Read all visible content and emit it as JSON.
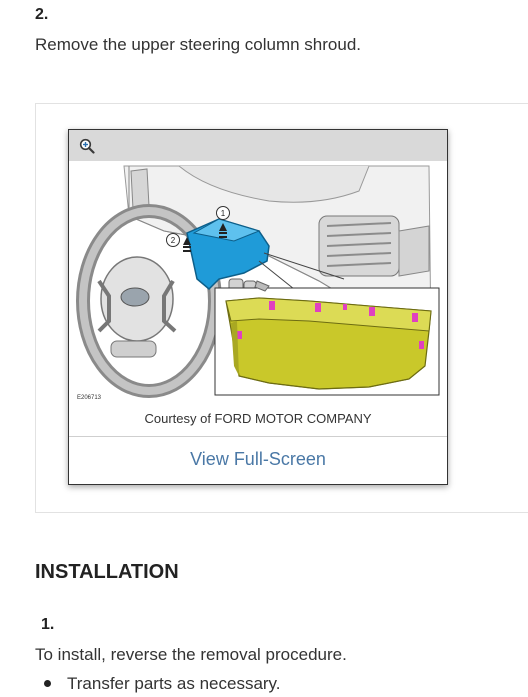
{
  "step": {
    "number": "2.",
    "instruction": "Remove the upper steering column shroud."
  },
  "figure": {
    "figure_id": "E206713",
    "callout_1": "1",
    "callout_2": "2",
    "caption": "Courtesy of FORD MOTOR COMPANY",
    "fullscreen_label": "View Full-Screen",
    "zoom_icon": "zoom-in-icon"
  },
  "installation": {
    "heading": "INSTALLATION",
    "step_number": "1.",
    "instruction": "To install, reverse the removal procedure.",
    "bullets": [
      "Transfer parts as necessary."
    ]
  },
  "colors": {
    "shroud_blue": "#1f9bd8",
    "detail_yellow": "#c9c82a",
    "clip_magenta": "#e040c0",
    "link_blue": "#4a78a6"
  }
}
